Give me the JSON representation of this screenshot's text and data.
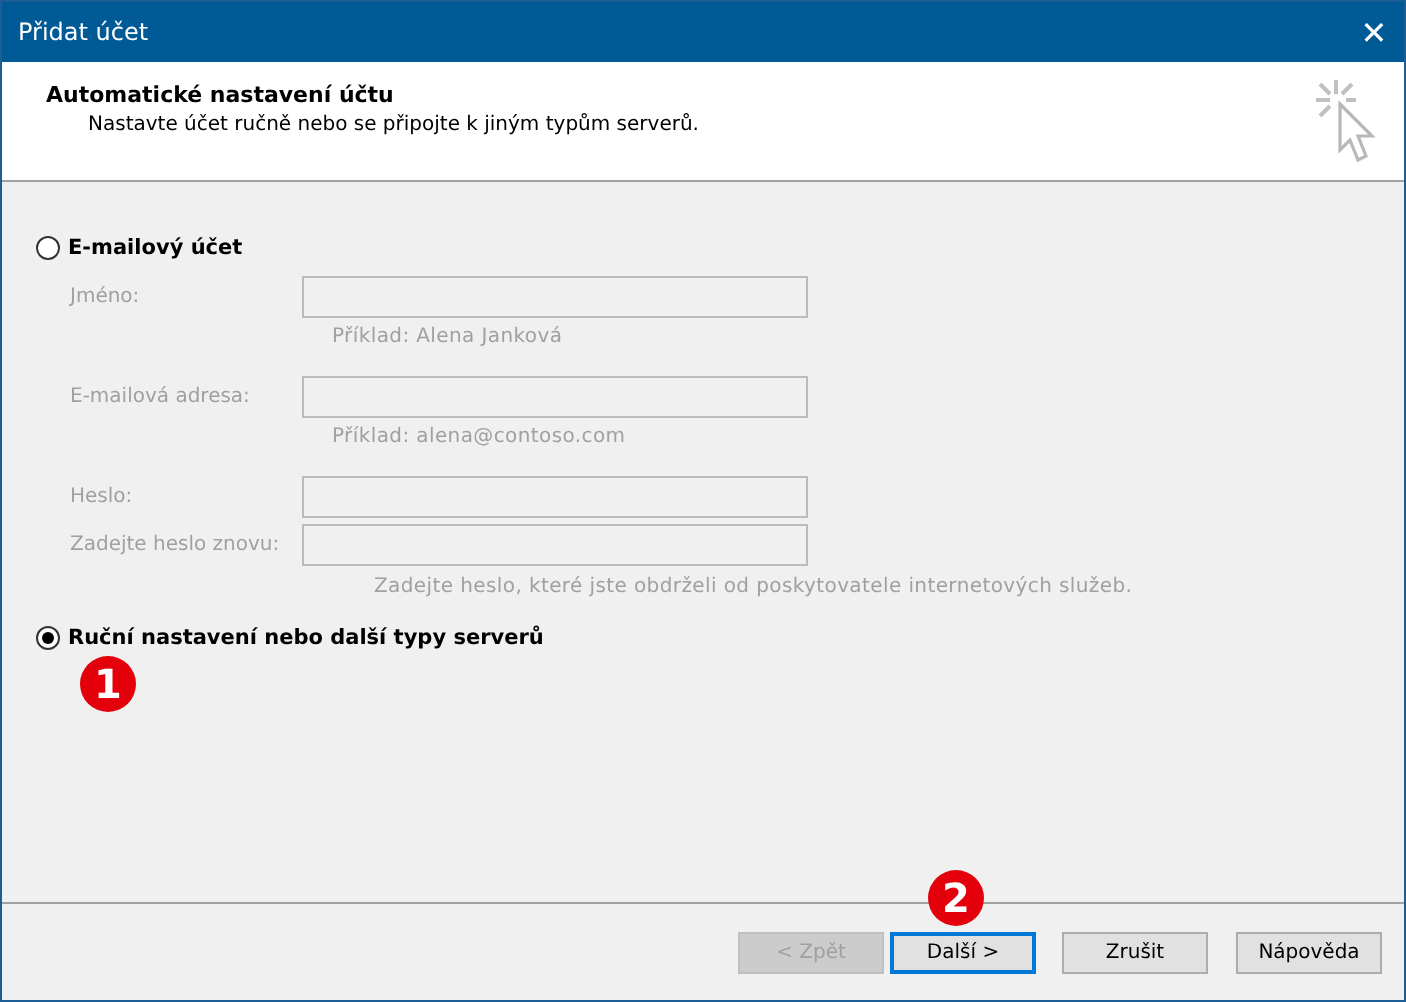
{
  "window": {
    "title": "Přidat účet",
    "close": "✕"
  },
  "header": {
    "title": "Automatické nastavení účtu",
    "subtitle": "Nastavte účet ručně nebo se připojte k jiným typům serverů."
  },
  "options": [
    {
      "label": "E-mailový účet",
      "selected": false,
      "disabled_fields": true,
      "fields": [
        {
          "label": "Jméno:",
          "hint": "Příklad: Alena Janková"
        },
        {
          "label": "E-mailová adresa:",
          "hint": "Příklad: alena@contoso.com"
        },
        {
          "label": "Heslo:"
        },
        {
          "label": "Zadejte heslo znovu:"
        }
      ],
      "note": "Zadejte heslo, které jste obdrželi od poskytovatele internetových služeb."
    },
    {
      "label": "Ruční nastavení nebo další typy serverů",
      "selected": true
    }
  ],
  "badges": [
    "1",
    "2"
  ],
  "buttons": [
    {
      "label": "< Zpět",
      "disabled": true,
      "default": false
    },
    {
      "label": "Další >",
      "disabled": false,
      "default": true
    },
    {
      "label": "Zrušit",
      "disabled": false,
      "default": false
    },
    {
      "label": "Nápověda",
      "disabled": false,
      "default": false
    }
  ]
}
